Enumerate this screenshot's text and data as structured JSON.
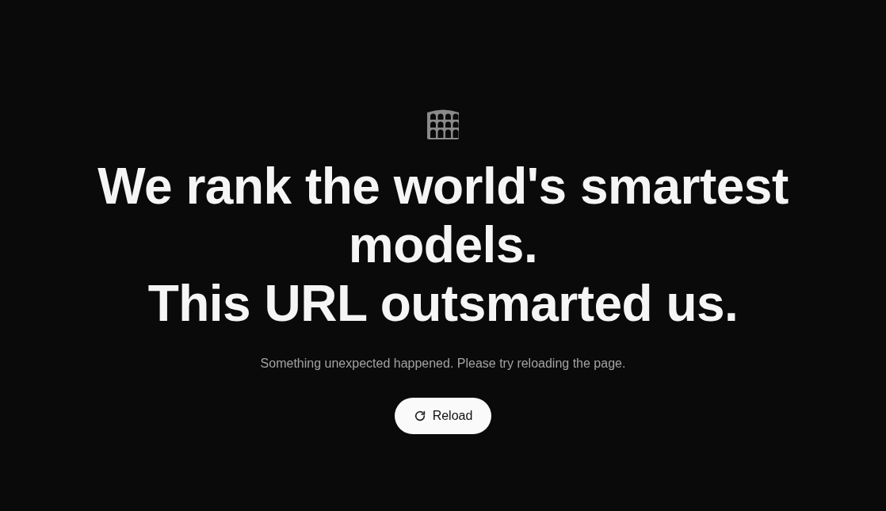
{
  "headline": [
    "We rank the world's smartest models.",
    "This URL outsmarted us."
  ],
  "message": "Something unexpected happened. Please try reloading the page.",
  "button": {
    "label": "Reload"
  }
}
